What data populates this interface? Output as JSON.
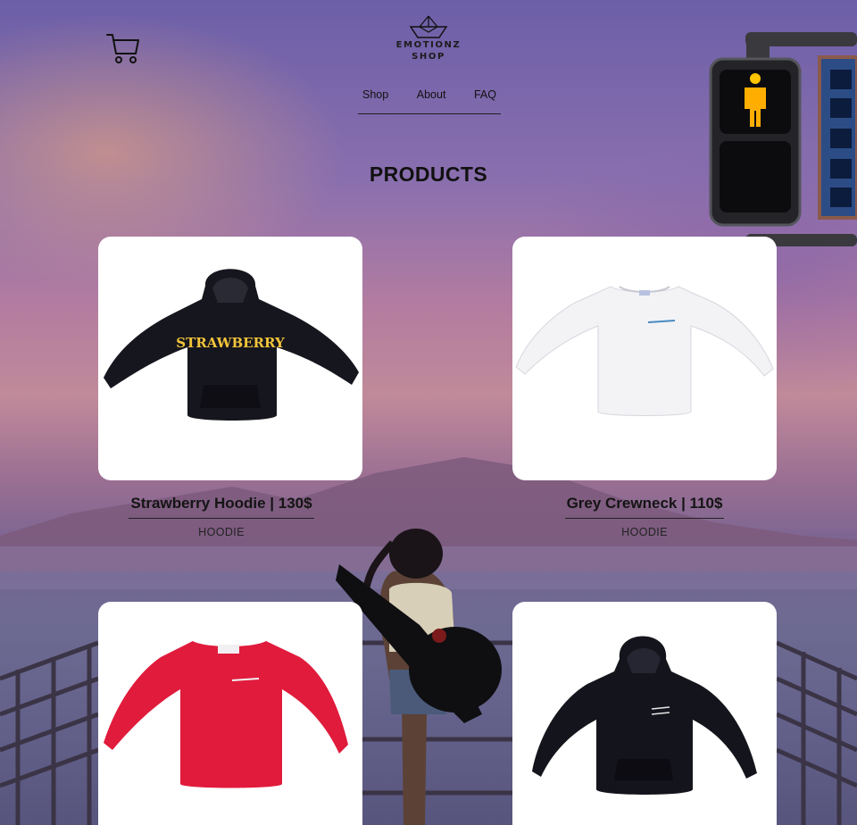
{
  "header": {
    "brand_name": "EMOTIONZ\nSHOP",
    "cart_icon": "shopping-cart-icon",
    "logo_icon": "paper-boat-icon"
  },
  "nav": {
    "items": [
      {
        "label": "Shop"
      },
      {
        "label": "About"
      },
      {
        "label": "FAQ"
      }
    ]
  },
  "page": {
    "title": "PRODUCTS"
  },
  "products": [
    {
      "title": "Strawberry Hoodie | 130$",
      "category": "HOODIE",
      "print_text": "STRAWBERRY",
      "color": "#16161e",
      "print_color": "#f2c53a"
    },
    {
      "title": "Grey Crewneck | 110$",
      "category": "HOODIE",
      "color": "#f3f3f6"
    },
    {
      "color": "#e01b3c"
    },
    {
      "color": "#14141c"
    }
  ]
}
